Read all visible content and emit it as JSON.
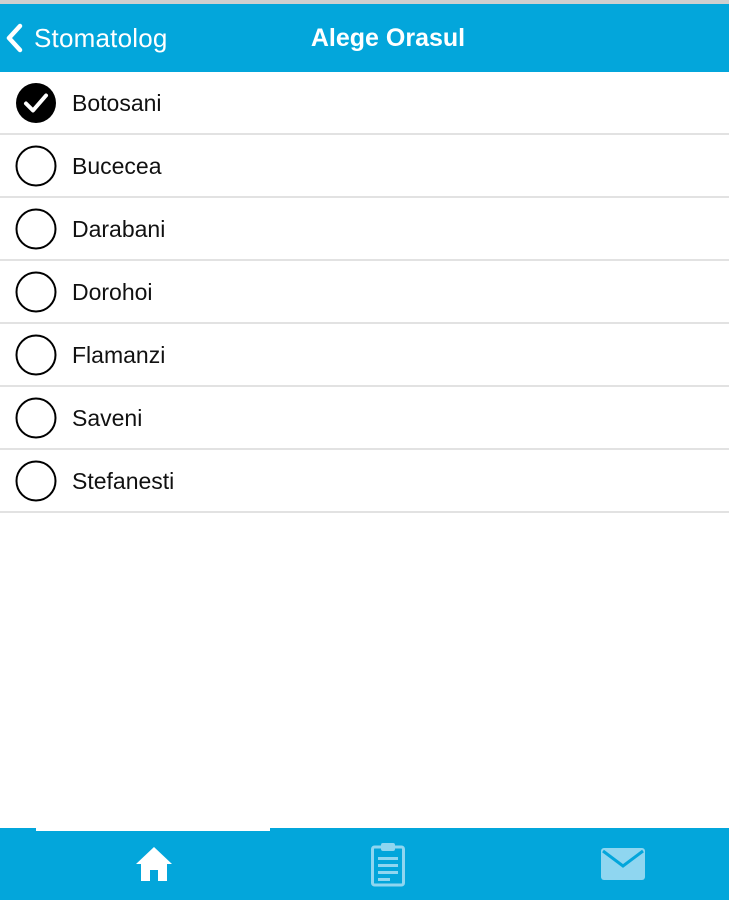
{
  "navbar": {
    "back_label": "Stomatolog",
    "title": "Alege Orasul",
    "background_color": "#03a6db"
  },
  "cities": [
    {
      "label": "Botosani",
      "selected": true
    },
    {
      "label": "Bucecea",
      "selected": false
    },
    {
      "label": "Darabani",
      "selected": false
    },
    {
      "label": "Dorohoi",
      "selected": false
    },
    {
      "label": "Flamanzi",
      "selected": false
    },
    {
      "label": "Saveni",
      "selected": false
    },
    {
      "label": "Stefanesti",
      "selected": false
    }
  ],
  "tabbar": {
    "tabs": [
      {
        "icon": "home-icon",
        "active": true
      },
      {
        "icon": "clipboard-icon",
        "active": false
      },
      {
        "icon": "mail-icon",
        "active": false
      }
    ],
    "active_color": "#ffffff",
    "inactive_color": "#8fd6f0"
  }
}
